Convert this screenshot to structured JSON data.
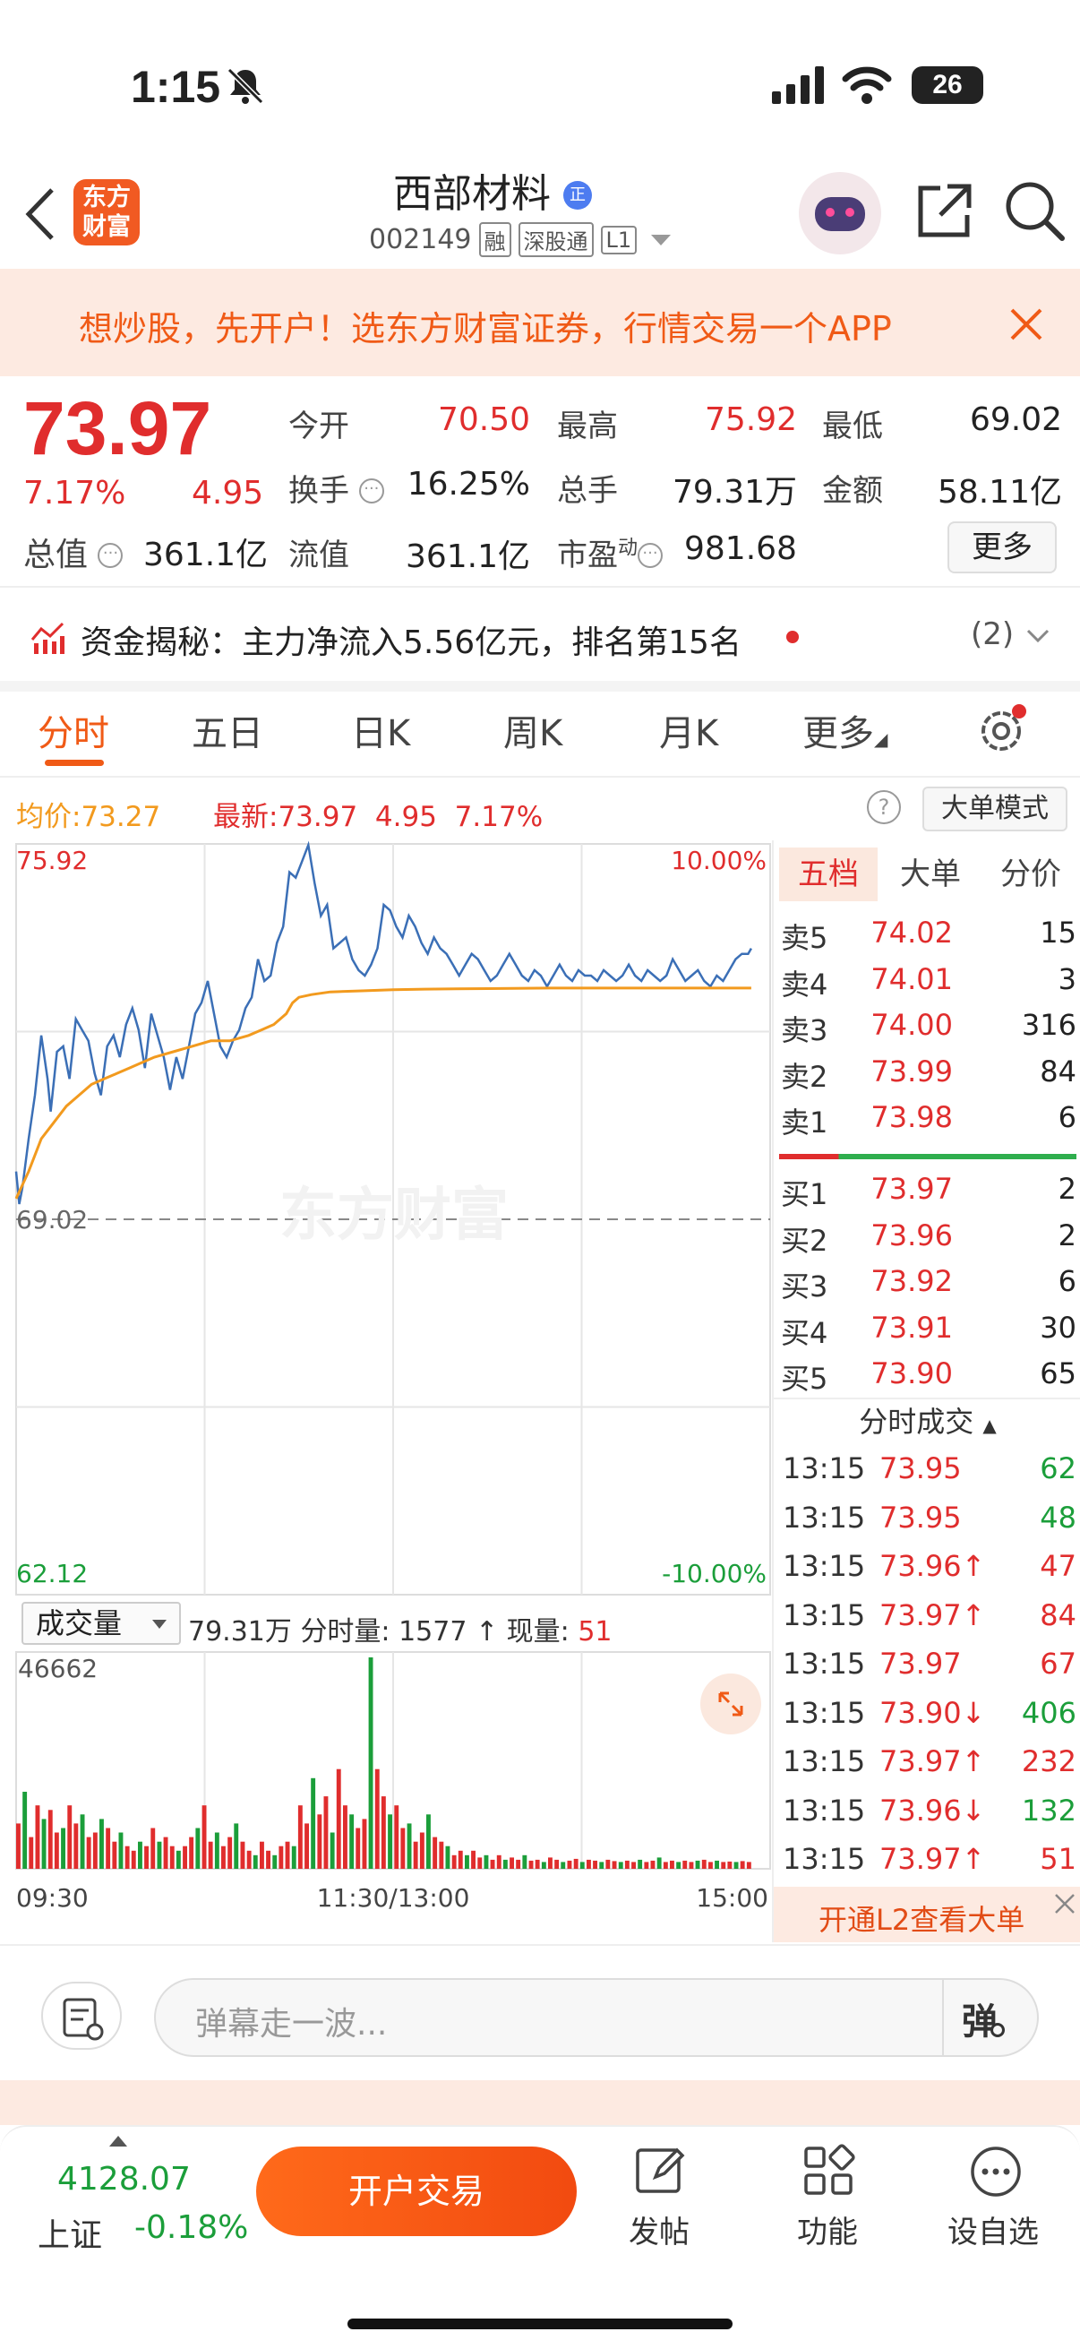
{
  "status_bar": {
    "time": "1:15",
    "battery": "26"
  },
  "header": {
    "logo_line1": "东方",
    "logo_line2": "财富",
    "stock_name": "西部材料",
    "stock_code": "002149",
    "tags": [
      "融",
      "深股通",
      "L1"
    ]
  },
  "banner": {
    "text": "想炒股，先开户！选东方财富证券，行情交易一个APP"
  },
  "quote": {
    "price": "73.97",
    "change_pct": "7.17%",
    "change": "4.95",
    "stats": [
      {
        "label": "今开",
        "value": "70.50",
        "color": "red"
      },
      {
        "label": "最高",
        "value": "75.92",
        "color": "red"
      },
      {
        "label": "最低",
        "value": "69.02",
        "color": "dark"
      },
      {
        "label": "换手",
        "value": "16.25%",
        "color": "dark"
      },
      {
        "label": "总手",
        "value": "79.31万",
        "color": "dark"
      },
      {
        "label": "金额",
        "value": "58.11亿",
        "color": "dark"
      },
      {
        "label": "总值",
        "value": "361.1亿",
        "color": "dark"
      },
      {
        "label": "流值",
        "value": "361.1亿",
        "color": "dark"
      },
      {
        "label": "市盈",
        "value": "981.68",
        "color": "dark"
      }
    ],
    "pe_sup": "动",
    "more_label": "更多"
  },
  "capital": {
    "text": "资金揭秘：主力净流入5.56亿元，排名第15名",
    "count": "(2)"
  },
  "tabs": [
    "分时",
    "五日",
    "日K",
    "周K",
    "月K",
    "更多"
  ],
  "chart_info": {
    "avg_label": "均价:",
    "avg_value": "73.27",
    "latest_label": "最新:",
    "latest_value": "73.97",
    "change": "4.95",
    "pct": "7.17%",
    "big_order_mode": "大单模式",
    "watermark": "东方财富"
  },
  "chart_data": {
    "type": "line",
    "title": "",
    "ylim": [
      62.12,
      75.92
    ],
    "prev_close": 69.02,
    "y_labels": {
      "top": "75.92",
      "mid": "69.02",
      "bottom": "62.12",
      "top_pct": "10.00%",
      "bottom_pct": "-10.00%"
    },
    "x_labels": [
      "09:30",
      "11:30/13:00",
      "15:00"
    ],
    "total_minutes": 240,
    "series": [
      {
        "name": "",
        "color": "#3b6fb6",
        "points": [
          [
            0,
            69.9
          ],
          [
            1,
            69.3
          ],
          [
            2,
            69.6
          ],
          [
            4,
            70.5
          ],
          [
            6,
            71.3
          ],
          [
            8,
            72.4
          ],
          [
            10,
            71.6
          ],
          [
            11,
            71.0
          ],
          [
            13,
            72.1
          ],
          [
            15,
            72.2
          ],
          [
            17,
            71.6
          ],
          [
            19,
            72.7
          ],
          [
            21,
            72.5
          ],
          [
            23,
            72.3
          ],
          [
            25,
            71.7
          ],
          [
            27,
            71.3
          ],
          [
            29,
            72.2
          ],
          [
            31,
            72.4
          ],
          [
            33,
            72.0
          ],
          [
            35,
            72.6
          ],
          [
            37,
            72.9
          ],
          [
            39,
            72.5
          ],
          [
            41,
            71.8
          ],
          [
            43,
            72.8
          ],
          [
            45,
            72.4
          ],
          [
            47,
            72.0
          ],
          [
            49,
            71.4
          ],
          [
            51,
            72.0
          ],
          [
            53,
            71.6
          ],
          [
            55,
            72.2
          ],
          [
            57,
            72.8
          ],
          [
            59,
            73.0
          ],
          [
            61,
            73.4
          ],
          [
            63,
            72.8
          ],
          [
            65,
            72.2
          ],
          [
            67,
            72.0
          ],
          [
            69,
            72.3
          ],
          [
            71,
            72.5
          ],
          [
            73,
            72.9
          ],
          [
            75,
            73.1
          ],
          [
            77,
            73.8
          ],
          [
            79,
            73.4
          ],
          [
            81,
            73.5
          ],
          [
            83,
            74.1
          ],
          [
            85,
            74.4
          ],
          [
            87,
            75.4
          ],
          [
            89,
            75.3
          ],
          [
            91,
            75.6
          ],
          [
            93,
            75.9
          ],
          [
            95,
            75.2
          ],
          [
            97,
            74.6
          ],
          [
            99,
            74.8
          ],
          [
            101,
            74.0
          ],
          [
            103,
            74.1
          ],
          [
            105,
            74.2
          ],
          [
            107,
            73.8
          ],
          [
            109,
            73.6
          ],
          [
            111,
            73.5
          ],
          [
            113,
            73.7
          ],
          [
            115,
            74.0
          ],
          [
            117,
            74.8
          ],
          [
            119,
            74.7
          ],
          [
            121,
            74.4
          ],
          [
            123,
            74.2
          ],
          [
            125,
            74.6
          ],
          [
            127,
            74.4
          ],
          [
            129,
            74.1
          ],
          [
            131,
            73.9
          ],
          [
            133,
            74.2
          ],
          [
            135,
            74.0
          ],
          [
            137,
            73.9
          ],
          [
            139,
            73.7
          ],
          [
            141,
            73.5
          ],
          [
            143,
            73.7
          ],
          [
            145,
            73.9
          ],
          [
            147,
            73.8
          ],
          [
            149,
            73.6
          ],
          [
            151,
            73.4
          ],
          [
            153,
            73.5
          ],
          [
            155,
            73.7
          ],
          [
            157,
            73.9
          ],
          [
            159,
            73.7
          ],
          [
            161,
            73.5
          ],
          [
            163,
            73.4
          ],
          [
            165,
            73.6
          ],
          [
            167,
            73.5
          ],
          [
            169,
            73.3
          ],
          [
            171,
            73.5
          ],
          [
            173,
            73.7
          ],
          [
            175,
            73.5
          ],
          [
            177,
            73.4
          ],
          [
            179,
            73.6
          ],
          [
            181,
            73.5
          ],
          [
            183,
            73.5
          ],
          [
            185,
            73.4
          ],
          [
            187,
            73.6
          ],
          [
            189,
            73.5
          ],
          [
            191,
            73.4
          ],
          [
            193,
            73.5
          ],
          [
            195,
            73.7
          ],
          [
            197,
            73.5
          ],
          [
            199,
            73.4
          ],
          [
            201,
            73.6
          ],
          [
            203,
            73.5
          ],
          [
            205,
            73.4
          ],
          [
            207,
            73.5
          ],
          [
            209,
            73.8
          ],
          [
            211,
            73.6
          ],
          [
            213,
            73.4
          ],
          [
            215,
            73.5
          ],
          [
            217,
            73.6
          ],
          [
            219,
            73.4
          ],
          [
            221,
            73.3
          ],
          [
            223,
            73.5
          ],
          [
            225,
            73.4
          ],
          [
            227,
            73.6
          ],
          [
            229,
            73.8
          ],
          [
            231,
            73.9
          ],
          [
            233,
            73.9
          ],
          [
            234,
            74.0
          ]
        ]
      },
      {
        "name": "",
        "color": "#f29a1e",
        "points": [
          [
            0,
            69.4
          ],
          [
            4,
            69.9
          ],
          [
            8,
            70.5
          ],
          [
            12,
            70.8
          ],
          [
            16,
            71.1
          ],
          [
            20,
            71.3
          ],
          [
            24,
            71.5
          ],
          [
            28,
            71.6
          ],
          [
            32,
            71.7
          ],
          [
            36,
            71.8
          ],
          [
            40,
            71.9
          ],
          [
            44,
            72.0
          ],
          [
            50,
            72.1
          ],
          [
            56,
            72.2
          ],
          [
            62,
            72.3
          ],
          [
            68,
            72.3
          ],
          [
            74,
            72.4
          ],
          [
            78,
            72.5
          ],
          [
            82,
            72.6
          ],
          [
            86,
            72.8
          ],
          [
            88,
            73.0
          ],
          [
            90,
            73.1
          ],
          [
            94,
            73.15
          ],
          [
            100,
            73.2
          ],
          [
            110,
            73.22
          ],
          [
            120,
            73.24
          ],
          [
            130,
            73.25
          ],
          [
            150,
            73.26
          ],
          [
            170,
            73.27
          ],
          [
            190,
            73.27
          ],
          [
            210,
            73.27
          ],
          [
            234,
            73.27
          ]
        ]
      }
    ]
  },
  "volume_chart": {
    "selector": "成交量",
    "total": "79.31万",
    "minute_label": "分时量:",
    "minute_value": "1577",
    "current_label": "现量:",
    "current_value": "51",
    "max_label": "46662",
    "chart_data": {
      "type": "bar",
      "ylim": [
        0,
        46662
      ],
      "count": 115,
      "values": [
        10000,
        17000,
        7000,
        14000,
        11000,
        13000,
        8000,
        9000,
        14000,
        10000,
        12000,
        7000,
        8000,
        11000,
        9000,
        6000,
        8000,
        5000,
        4000,
        6000,
        5000,
        9000,
        6000,
        7000,
        5000,
        4000,
        5000,
        7000,
        9000,
        14000,
        6000,
        8000,
        5000,
        7000,
        10000,
        6000,
        4000,
        3000,
        6000,
        4000,
        3000,
        5000,
        6000,
        5000,
        14000,
        10000,
        20000,
        12000,
        16000,
        8000,
        22000,
        14000,
        12000,
        9000,
        11000,
        46662,
        22000,
        16000,
        12000,
        14000,
        9000,
        10000,
        6000,
        8000,
        12000,
        7000,
        6000,
        5000,
        3000,
        4000,
        3000,
        4000,
        2500,
        3000,
        2000,
        3000,
        2000,
        2500,
        2000,
        3000,
        1800,
        2000,
        1500,
        2500,
        2000,
        1500,
        1800,
        2200,
        1500,
        2000,
        1800,
        1500,
        2000,
        1700,
        1500,
        1800,
        1500,
        2000,
        1500,
        1800,
        2500,
        1500,
        1800,
        1500,
        1800,
        1500,
        1800,
        2000,
        1500,
        1800,
        1500,
        1600,
        1500,
        1700,
        1500
      ],
      "colors": "alternating"
    }
  },
  "order_book": {
    "tabs": [
      "五档",
      "大单",
      "分价"
    ],
    "asks": [
      {
        "label": "卖5",
        "price": "74.02",
        "vol": "15"
      },
      {
        "label": "卖4",
        "price": "74.01",
        "vol": "3"
      },
      {
        "label": "卖3",
        "price": "74.00",
        "vol": "316"
      },
      {
        "label": "卖2",
        "price": "73.99",
        "vol": "84"
      },
      {
        "label": "卖1",
        "price": "73.98",
        "vol": "6"
      }
    ],
    "bids": [
      {
        "label": "买1",
        "price": "73.97",
        "vol": "2"
      },
      {
        "label": "买2",
        "price": "73.96",
        "vol": "2"
      },
      {
        "label": "买3",
        "price": "73.92",
        "vol": "6"
      },
      {
        "label": "买4",
        "price": "73.91",
        "vol": "30"
      },
      {
        "label": "买5",
        "price": "73.90",
        "vol": "65"
      }
    ],
    "ticks_header": "分时成交",
    "ticks": [
      {
        "time": "13:15",
        "price": "73.95",
        "vol": "62",
        "vc": "green"
      },
      {
        "time": "13:15",
        "price": "73.95",
        "vol": "48",
        "vc": "green"
      },
      {
        "time": "13:15",
        "price": "73.96↑",
        "vol": "47",
        "vc": "red"
      },
      {
        "time": "13:15",
        "price": "73.97↑",
        "vol": "84",
        "vc": "red"
      },
      {
        "time": "13:15",
        "price": "73.97",
        "vol": "67",
        "vc": "red"
      },
      {
        "time": "13:15",
        "price": "73.90↓",
        "vol": "406",
        "vc": "green"
      },
      {
        "time": "13:15",
        "price": "73.97↑",
        "vol": "232",
        "vc": "red"
      },
      {
        "time": "13:15",
        "price": "73.96↓",
        "vol": "132",
        "vc": "green"
      },
      {
        "time": "13:15",
        "price": "73.97↑",
        "vol": "51",
        "vc": "red"
      }
    ],
    "l2_promo": "开通L2查看大单"
  },
  "comment": {
    "placeholder": "弹幕走一波...",
    "danmu_icon": "弹"
  },
  "bottom_bar": {
    "index_value": "4128.07",
    "index_name": "上证",
    "index_pct": "-0.18%",
    "trade_button": "开户交易",
    "post": "发帖",
    "func": "功能",
    "watch": "设自选"
  }
}
